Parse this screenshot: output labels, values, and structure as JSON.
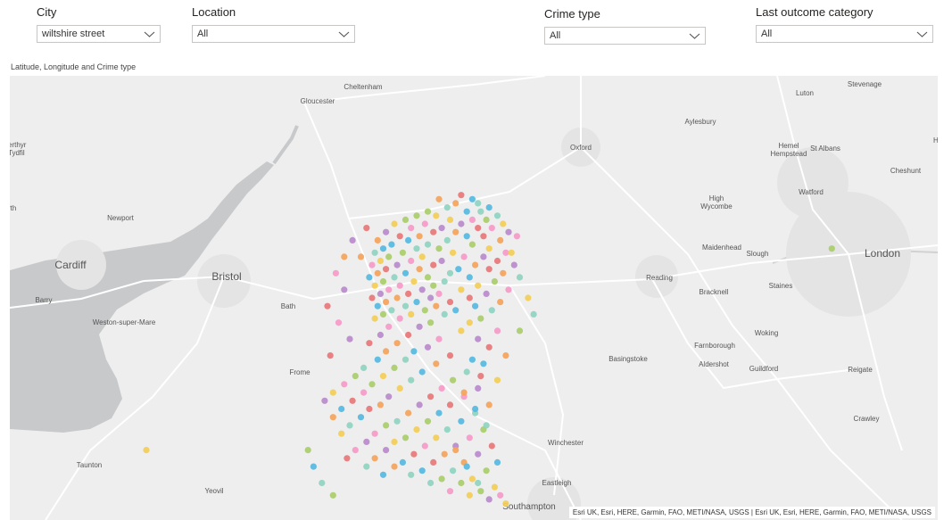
{
  "slicers": [
    {
      "title": "City",
      "value": "wiltshire street"
    },
    {
      "title": "Location",
      "value": "All"
    },
    {
      "title": "Crime type",
      "value": "All"
    },
    {
      "title": "Last outcome category",
      "value": "All"
    }
  ],
  "visual_title": "Latitude, Longitude and Crime type",
  "attribution": "Esri UK, Esri, HERE, Garmin, FAO, METI/NASA, USGS | Esri UK, Esri, HERE, Garmin, FAO, METI/NASA, USGS",
  "places": [
    "Cheltenham",
    "Gloucester",
    "Luton",
    "Stevenage",
    "Aylesbury",
    "Oxford",
    "Hemel Hempstead",
    "St Albans",
    "Cheshunt",
    "erthyr Tydfil",
    "rth",
    "Newport",
    "Cardiff",
    "Bristol",
    "Barry",
    "Bath",
    "Weston-super-Mare",
    "High Wycombe",
    "Watford",
    "Maidenhead",
    "Slough",
    "London",
    "Reading",
    "Bracknell",
    "Staines",
    "Woking",
    "Farnborough",
    "Basingstoke",
    "Aldershot",
    "Guildford",
    "Reigate",
    "Frome",
    "Crawley",
    "Winchester",
    "Taunton",
    "Yeovil",
    "Eastleigh",
    "Southampton",
    "He"
  ],
  "colors": {
    "water": "#c7c9cb",
    "land": "#eeeeee",
    "urban": "#e5e5e5",
    "road": "#ffffff",
    "crime_palette": [
      "#e8777a",
      "#f2cd56",
      "#55b8e0",
      "#b98acb",
      "#a9cd6a",
      "#f5a35b",
      "#f59ac8",
      "#8fd3c1"
    ]
  },
  "chart_data": {
    "type": "scatter",
    "title": "Latitude, Longitude and Crime type",
    "xlabel": "Longitude",
    "ylabel": "Latitude",
    "xlim": [
      -3.38,
      -0.05
    ],
    "ylim": [
      50.91,
      51.99
    ],
    "legend": "none",
    "series": [
      {
        "points": [
          [
            -1.76,
            51.7
          ],
          [
            -1.84,
            51.69
          ],
          [
            -1.72,
            51.69
          ],
          [
            -1.7,
            51.68
          ],
          [
            -1.78,
            51.68
          ],
          [
            -1.66,
            51.67
          ],
          [
            -1.81,
            51.67
          ],
          [
            -1.88,
            51.66
          ],
          [
            -1.74,
            51.66
          ],
          [
            -1.69,
            51.66
          ],
          [
            -1.92,
            51.65
          ],
          [
            -1.85,
            51.65
          ],
          [
            -1.63,
            51.65
          ],
          [
            -1.96,
            51.64
          ],
          [
            -1.8,
            51.64
          ],
          [
            -1.72,
            51.64
          ],
          [
            -1.67,
            51.64
          ],
          [
            -2.0,
            51.63
          ],
          [
            -1.89,
            51.63
          ],
          [
            -1.76,
            51.63
          ],
          [
            -1.61,
            51.63
          ],
          [
            -1.94,
            51.62
          ],
          [
            -1.83,
            51.62
          ],
          [
            -1.7,
            51.62
          ],
          [
            -1.65,
            51.62
          ],
          [
            -2.03,
            51.61
          ],
          [
            -1.86,
            51.61
          ],
          [
            -1.78,
            51.61
          ],
          [
            -1.59,
            51.61
          ],
          [
            -1.98,
            51.6
          ],
          [
            -1.91,
            51.6
          ],
          [
            -1.74,
            51.6
          ],
          [
            -1.68,
            51.6
          ],
          [
            -2.06,
            51.59
          ],
          [
            -1.95,
            51.59
          ],
          [
            -1.81,
            51.59
          ],
          [
            -1.62,
            51.59
          ],
          [
            -2.01,
            51.58
          ],
          [
            -1.88,
            51.58
          ],
          [
            -1.72,
            51.58
          ],
          [
            -2.04,
            51.57
          ],
          [
            -1.92,
            51.57
          ],
          [
            -1.84,
            51.57
          ],
          [
            -1.66,
            51.57
          ],
          [
            -2.07,
            51.56
          ],
          [
            -1.97,
            51.56
          ],
          [
            -1.79,
            51.56
          ],
          [
            -1.6,
            51.56
          ],
          [
            -2.02,
            51.55
          ],
          [
            -1.9,
            51.55
          ],
          [
            -1.75,
            51.55
          ],
          [
            -1.68,
            51.55
          ],
          [
            -2.05,
            51.54
          ],
          [
            -1.94,
            51.54
          ],
          [
            -1.83,
            51.54
          ],
          [
            -1.63,
            51.54
          ],
          [
            -2.08,
            51.53
          ],
          [
            -1.99,
            51.53
          ],
          [
            -1.86,
            51.53
          ],
          [
            -1.71,
            51.53
          ],
          [
            -1.57,
            51.53
          ],
          [
            -2.03,
            51.52
          ],
          [
            -1.91,
            51.52
          ],
          [
            -1.77,
            51.52
          ],
          [
            -1.66,
            51.52
          ],
          [
            -2.06,
            51.51
          ],
          [
            -1.96,
            51.51
          ],
          [
            -1.8,
            51.51
          ],
          [
            -1.61,
            51.51
          ],
          [
            -2.09,
            51.5
          ],
          [
            -2.0,
            51.5
          ],
          [
            -1.88,
            51.5
          ],
          [
            -1.73,
            51.5
          ],
          [
            -1.55,
            51.5
          ],
          [
            -2.04,
            51.49
          ],
          [
            -1.93,
            51.49
          ],
          [
            -1.82,
            51.49
          ],
          [
            -1.64,
            51.49
          ],
          [
            -2.07,
            51.48
          ],
          [
            -1.98,
            51.48
          ],
          [
            -1.86,
            51.48
          ],
          [
            -1.7,
            51.48
          ],
          [
            -2.02,
            51.47
          ],
          [
            -1.9,
            51.47
          ],
          [
            -1.76,
            51.47
          ],
          [
            -1.59,
            51.47
          ],
          [
            -2.05,
            51.46
          ],
          [
            -1.95,
            51.46
          ],
          [
            -1.84,
            51.46
          ],
          [
            -1.67,
            51.46
          ],
          [
            -2.08,
            51.45
          ],
          [
            -1.99,
            51.45
          ],
          [
            -1.87,
            51.45
          ],
          [
            -1.73,
            51.45
          ],
          [
            -2.03,
            51.44
          ],
          [
            -1.92,
            51.44
          ],
          [
            -1.8,
            51.44
          ],
          [
            -1.62,
            51.44
          ],
          [
            -2.06,
            51.43
          ],
          [
            -1.96,
            51.43
          ],
          [
            -1.85,
            51.43
          ],
          [
            -1.71,
            51.43
          ],
          [
            -2.01,
            51.42
          ],
          [
            -1.89,
            51.42
          ],
          [
            -1.78,
            51.42
          ],
          [
            -1.65,
            51.42
          ],
          [
            -2.04,
            51.41
          ],
          [
            -1.94,
            51.41
          ],
          [
            -1.82,
            51.41
          ],
          [
            -1.69,
            51.4
          ],
          [
            -2.07,
            51.4
          ],
          [
            -1.98,
            51.4
          ],
          [
            -1.87,
            51.39
          ],
          [
            -1.73,
            51.39
          ],
          [
            -2.02,
            51.38
          ],
          [
            -1.91,
            51.38
          ],
          [
            -1.76,
            51.37
          ],
          [
            -1.63,
            51.37
          ],
          [
            -2.05,
            51.36
          ],
          [
            -1.95,
            51.36
          ],
          [
            -1.84,
            51.35
          ],
          [
            -1.7,
            51.35
          ],
          [
            -2.09,
            51.34
          ],
          [
            -1.99,
            51.34
          ],
          [
            -1.88,
            51.33
          ],
          [
            -1.66,
            51.33
          ],
          [
            -2.03,
            51.32
          ],
          [
            -1.93,
            51.32
          ],
          [
            -1.8,
            51.31
          ],
          [
            -1.6,
            51.31
          ],
          [
            -2.06,
            51.3
          ],
          [
            -1.96,
            51.3
          ],
          [
            -1.85,
            51.29
          ],
          [
            -1.68,
            51.29
          ],
          [
            -2.11,
            51.28
          ],
          [
            -2.0,
            51.28
          ],
          [
            -1.9,
            51.27
          ],
          [
            -1.74,
            51.27
          ],
          [
            -2.14,
            51.26
          ],
          [
            -2.04,
            51.26
          ],
          [
            -1.94,
            51.25
          ],
          [
            -1.79,
            51.25
          ],
          [
            -1.63,
            51.25
          ],
          [
            -2.18,
            51.24
          ],
          [
            -2.08,
            51.24
          ],
          [
            -1.98,
            51.23
          ],
          [
            -1.83,
            51.23
          ],
          [
            -1.7,
            51.23
          ],
          [
            -2.22,
            51.22
          ],
          [
            -2.11,
            51.22
          ],
          [
            -2.02,
            51.21
          ],
          [
            -1.87,
            51.21
          ],
          [
            -1.75,
            51.21
          ],
          [
            -2.25,
            51.2
          ],
          [
            -2.15,
            51.2
          ],
          [
            -2.05,
            51.19
          ],
          [
            -1.91,
            51.19
          ],
          [
            -1.8,
            51.19
          ],
          [
            -1.66,
            51.19
          ],
          [
            -2.19,
            51.18
          ],
          [
            -2.09,
            51.18
          ],
          [
            -1.95,
            51.17
          ],
          [
            -1.84,
            51.17
          ],
          [
            -1.71,
            51.17
          ],
          [
            -2.22,
            51.16
          ],
          [
            -2.12,
            51.16
          ],
          [
            -1.99,
            51.15
          ],
          [
            -1.88,
            51.15
          ],
          [
            -1.76,
            51.15
          ],
          [
            -2.16,
            51.14
          ],
          [
            -2.03,
            51.14
          ],
          [
            -1.92,
            51.13
          ],
          [
            -1.81,
            51.13
          ],
          [
            -1.68,
            51.13
          ],
          [
            -2.19,
            51.12
          ],
          [
            -2.07,
            51.12
          ],
          [
            -1.96,
            51.11
          ],
          [
            -1.85,
            51.11
          ],
          [
            -1.73,
            51.11
          ],
          [
            -2.1,
            51.1
          ],
          [
            -2.0,
            51.1
          ],
          [
            -1.89,
            51.09
          ],
          [
            -1.78,
            51.09
          ],
          [
            -1.65,
            51.09
          ],
          [
            -2.14,
            51.08
          ],
          [
            -2.03,
            51.08
          ],
          [
            -1.93,
            51.07
          ],
          [
            -1.82,
            51.07
          ],
          [
            -1.7,
            51.07
          ],
          [
            -2.17,
            51.06
          ],
          [
            -2.07,
            51.06
          ],
          [
            -1.97,
            51.05
          ],
          [
            -1.86,
            51.05
          ],
          [
            -1.75,
            51.05
          ],
          [
            -1.63,
            51.05
          ],
          [
            -2.1,
            51.04
          ],
          [
            -2.0,
            51.04
          ],
          [
            -1.9,
            51.03
          ],
          [
            -1.79,
            51.03
          ],
          [
            -1.67,
            51.03
          ],
          [
            -2.04,
            51.02
          ],
          [
            -1.94,
            51.02
          ],
          [
            -1.83,
            51.01
          ],
          [
            -1.72,
            51.01
          ],
          [
            -1.87,
            51.0
          ],
          [
            -1.76,
            51.0
          ],
          [
            -1.64,
            50.99
          ],
          [
            -1.8,
            50.98
          ],
          [
            -1.69,
            50.98
          ],
          [
            -1.73,
            50.97
          ],
          [
            -1.62,
            50.97
          ],
          [
            -1.66,
            50.96
          ],
          [
            -1.6,
            50.95
          ],
          [
            -2.21,
            51.51
          ],
          [
            -2.18,
            51.47
          ],
          [
            -2.24,
            51.43
          ],
          [
            -2.2,
            51.39
          ],
          [
            -2.16,
            51.35
          ],
          [
            -2.23,
            51.31
          ],
          [
            -2.12,
            51.55
          ],
          [
            -2.15,
            51.59
          ],
          [
            -2.1,
            51.62
          ],
          [
            -2.18,
            51.55
          ],
          [
            -1.72,
            51.3
          ],
          [
            -1.69,
            51.26
          ],
          [
            -1.75,
            51.22
          ],
          [
            -1.71,
            51.18
          ],
          [
            -1.67,
            51.14
          ],
          [
            -1.78,
            51.08
          ],
          [
            -1.74,
            51.04
          ],
          [
            -1.7,
            51.0
          ],
          [
            -2.31,
            51.08
          ],
          [
            -2.29,
            51.04
          ],
          [
            -2.26,
            51.0
          ],
          [
            -2.22,
            50.97
          ],
          [
            -1.52,
            51.45
          ],
          [
            -1.5,
            51.41
          ],
          [
            -1.55,
            51.37
          ],
          [
            -1.58,
            51.56
          ],
          [
            -1.56,
            51.6
          ],
          [
            -0.43,
            51.57
          ],
          [
            -2.89,
            51.08
          ]
        ]
      }
    ]
  }
}
